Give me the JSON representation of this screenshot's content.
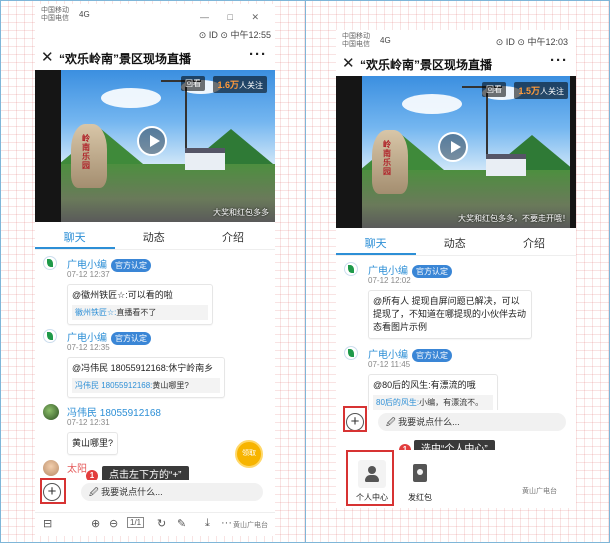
{
  "left": {
    "status": {
      "carrier": "中国移动\n中国电信",
      "signal": "4G",
      "time_text": "⊙ ⅠD ⊙ 中午12:55",
      "win_controls": "— □ ✕"
    },
    "title": "“欢乐岭南”景区现场直播",
    "video": {
      "replay": "回看",
      "watch_count": "1.6万",
      "watch_suffix": "人关注",
      "caption": "大奖和红包多多",
      "rock_text": "岭南乐园"
    },
    "tabs": [
      "聊天",
      "动态",
      "介绍"
    ],
    "messages": [
      {
        "name": "广电小编",
        "badge": "官方认定",
        "time": "07-12 12:37",
        "text": "@徽州铁匠☆:可以看的啦",
        "quote_name": "徽州铁匠☆:",
        "quote_text": "直播看不了"
      },
      {
        "name": "广电小编",
        "badge": "官方认定",
        "time": "07-12 12:35",
        "text": "@冯伟民 18055912168:休宁岭南乡",
        "quote_name": "冯伟民 18055912168:",
        "quote_text": "黄山哪里?"
      },
      {
        "name": "冯伟民 18055912168",
        "time": "07-12 12:31",
        "text": "黄山哪里?"
      },
      {
        "name": "太阳"
      }
    ],
    "gift_label": "领取",
    "step_number": "1",
    "tooltip": "点击左下方的“+”",
    "input_placeholder": "🖉 我要说点什么...",
    "plus": "+",
    "toolbar": {
      "layout": "⊟",
      "zoom_in": "⊕",
      "zoom_out": "⊖",
      "page": "1/1",
      "rotate": "↻",
      "edit": "✎",
      "download": "⤓",
      "more": "···"
    },
    "watermark": "黄山广电台"
  },
  "right": {
    "status": {
      "carrier": "中国移动\n中国电信",
      "signal": "4G",
      "time_text": "⊙ ⅠD ⊙ 中午12:03"
    },
    "title": "“欢乐岭南”景区现场直播",
    "video": {
      "replay": "回看",
      "watch_count": "1.5万",
      "watch_suffix": "人关注",
      "caption": "大奖和红包多多，不要走开哦！",
      "rock_text": "岭南乐园"
    },
    "tabs": [
      "聊天",
      "动态",
      "介绍"
    ],
    "messages": [
      {
        "name": "广电小编",
        "badge": "官方认定",
        "time": "07-12 12:02",
        "text": "@所有人 提现自屏问题已解决，可以提现了，不知道在哪提现的小伙伴去动态看图片示例"
      },
      {
        "name": "广电小编",
        "badge": "官方认定",
        "time": "07-12 11:45",
        "text": "@80后的风生:有漂流的哦",
        "quote_name": "80后的风生:",
        "quote_text": "小编，有漂流不。"
      }
    ],
    "plus": "+",
    "input_placeholder": "🖉 我要说点什么...",
    "step_number": "1",
    "tooltip": "选中“个人中心”",
    "panel": {
      "personal_center": "个人中心",
      "red_packet": "发红包"
    },
    "watermark": "黄山广电台"
  },
  "colors": {
    "accent": "#2d8fd6",
    "highlight_box": "#d73333",
    "badge_bg": "#3a86d6",
    "watch_count": "#ff9a3a"
  }
}
